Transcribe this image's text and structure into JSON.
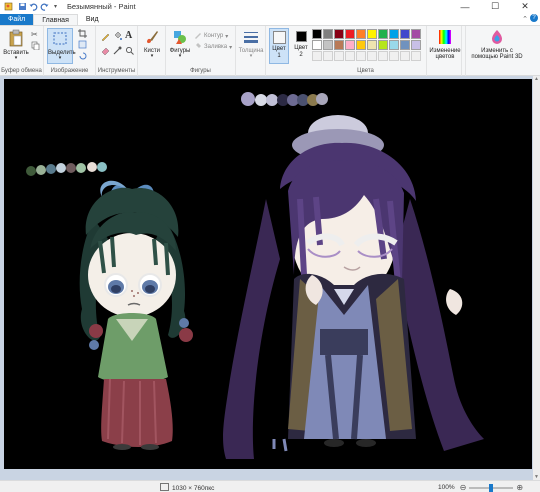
{
  "window": {
    "title": "Безымянный - Paint",
    "controls": {
      "minimize": "—",
      "maximize": "☐",
      "close": "✕"
    }
  },
  "tabs": [
    {
      "label": "Файл"
    },
    {
      "label": "Главная"
    },
    {
      "label": "Вид"
    }
  ],
  "ribbon": {
    "clipboard": {
      "paste": "Вставить",
      "group_label": "Буфер обмена"
    },
    "image": {
      "select": "Выделить",
      "group_label": "Изображение"
    },
    "tools": {
      "group_label": "Инструменты",
      "text_tool": "A"
    },
    "brushes": {
      "label": "Кисти"
    },
    "shapes": {
      "shapes": "Фигуры",
      "outline": "Контур",
      "fill": "Заливка",
      "group_label": "Фигуры"
    },
    "size": {
      "label": "Толщина"
    },
    "colors": {
      "color1": "Цвет\n1",
      "color1_line1": "Цвет",
      "color1_line2": "1",
      "color2_line1": "Цвет",
      "color2_line2": "2",
      "edit": "Изменение цветов",
      "edit_line1": "Изменение",
      "edit_line2": "цветов",
      "group_label": "Цвета",
      "palette": [
        "#000000",
        "#7f7f7f",
        "#880015",
        "#ed1c24",
        "#ff7f27",
        "#fff200",
        "#22b14c",
        "#00a2e8",
        "#3f48cc",
        "#a349a4",
        "#ffffff",
        "#c3c3c3",
        "#b97a57",
        "#ffaec9",
        "#ffc90e",
        "#efe4b0",
        "#b5e61d",
        "#99d9ea",
        "#7092be",
        "#c8bfe7",
        "#f0f0f0",
        "#f0f0f0",
        "#f0f0f0",
        "#f0f0f0",
        "#f0f0f0",
        "#f0f0f0",
        "#f0f0f0",
        "#f0f0f0",
        "#f0f0f0",
        "#f0f0f0"
      ]
    },
    "paint3d": {
      "line1": "Изменить с",
      "line2": "помощью Paint 3D"
    }
  },
  "status": {
    "dimensions": "1030 × 760пкс",
    "zoom": "100%"
  }
}
